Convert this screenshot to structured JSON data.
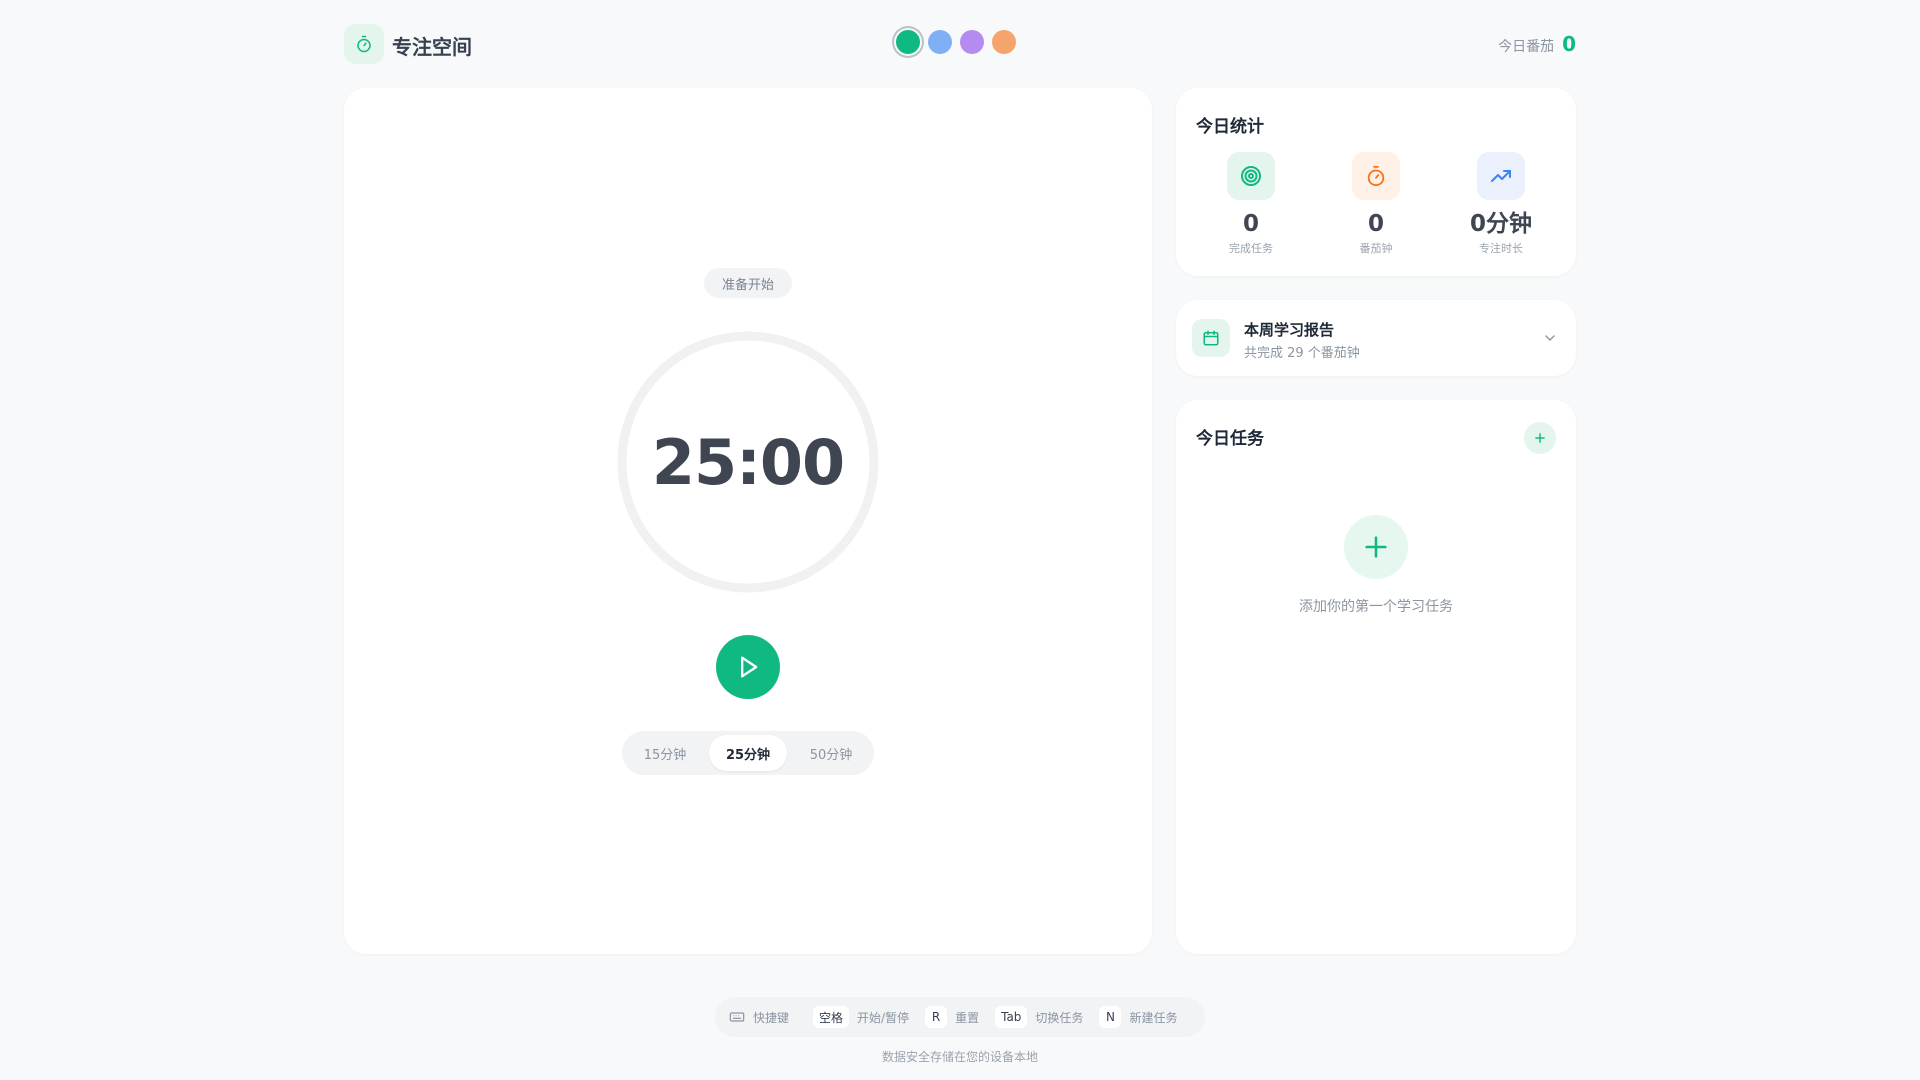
{
  "header": {
    "app_title": "专注空间",
    "theme_colors": [
      "#10b981",
      "#7fb0f5",
      "#b48bf0",
      "#f5a46b"
    ],
    "today_label": "今日番茄",
    "today_value": "0"
  },
  "timer": {
    "status": "准备开始",
    "time": "25:00",
    "durations": [
      "15分钟",
      "25分钟",
      "50分钟"
    ],
    "selected_duration": "25分钟"
  },
  "stats": {
    "title": "今日统计",
    "items": [
      {
        "value": "0",
        "label": "完成任务",
        "icon": "target-icon"
      },
      {
        "value": "0",
        "label": "番茄钟",
        "icon": "stopwatch-icon"
      },
      {
        "value": "0分钟",
        "label": "专注时长",
        "icon": "trend-up-icon"
      }
    ]
  },
  "report": {
    "title": "本周学习报告",
    "subtitle": "共完成 29 个番茄钟"
  },
  "tasks": {
    "title": "今日任务",
    "empty_text": "添加你的第一个学习任务"
  },
  "shortcuts": {
    "lead": "快捷键",
    "items": [
      {
        "key": "空格",
        "desc": "开始/暂停"
      },
      {
        "key": "R",
        "desc": "重置"
      },
      {
        "key": "Tab",
        "desc": "切换任务"
      },
      {
        "key": "N",
        "desc": "新建任务"
      }
    ]
  },
  "footer": {
    "note": "数据安全存储在您的设备本地"
  },
  "colors": {
    "accent": "#10b981",
    "orange": "#f97316",
    "blue": "#3b82f6"
  }
}
